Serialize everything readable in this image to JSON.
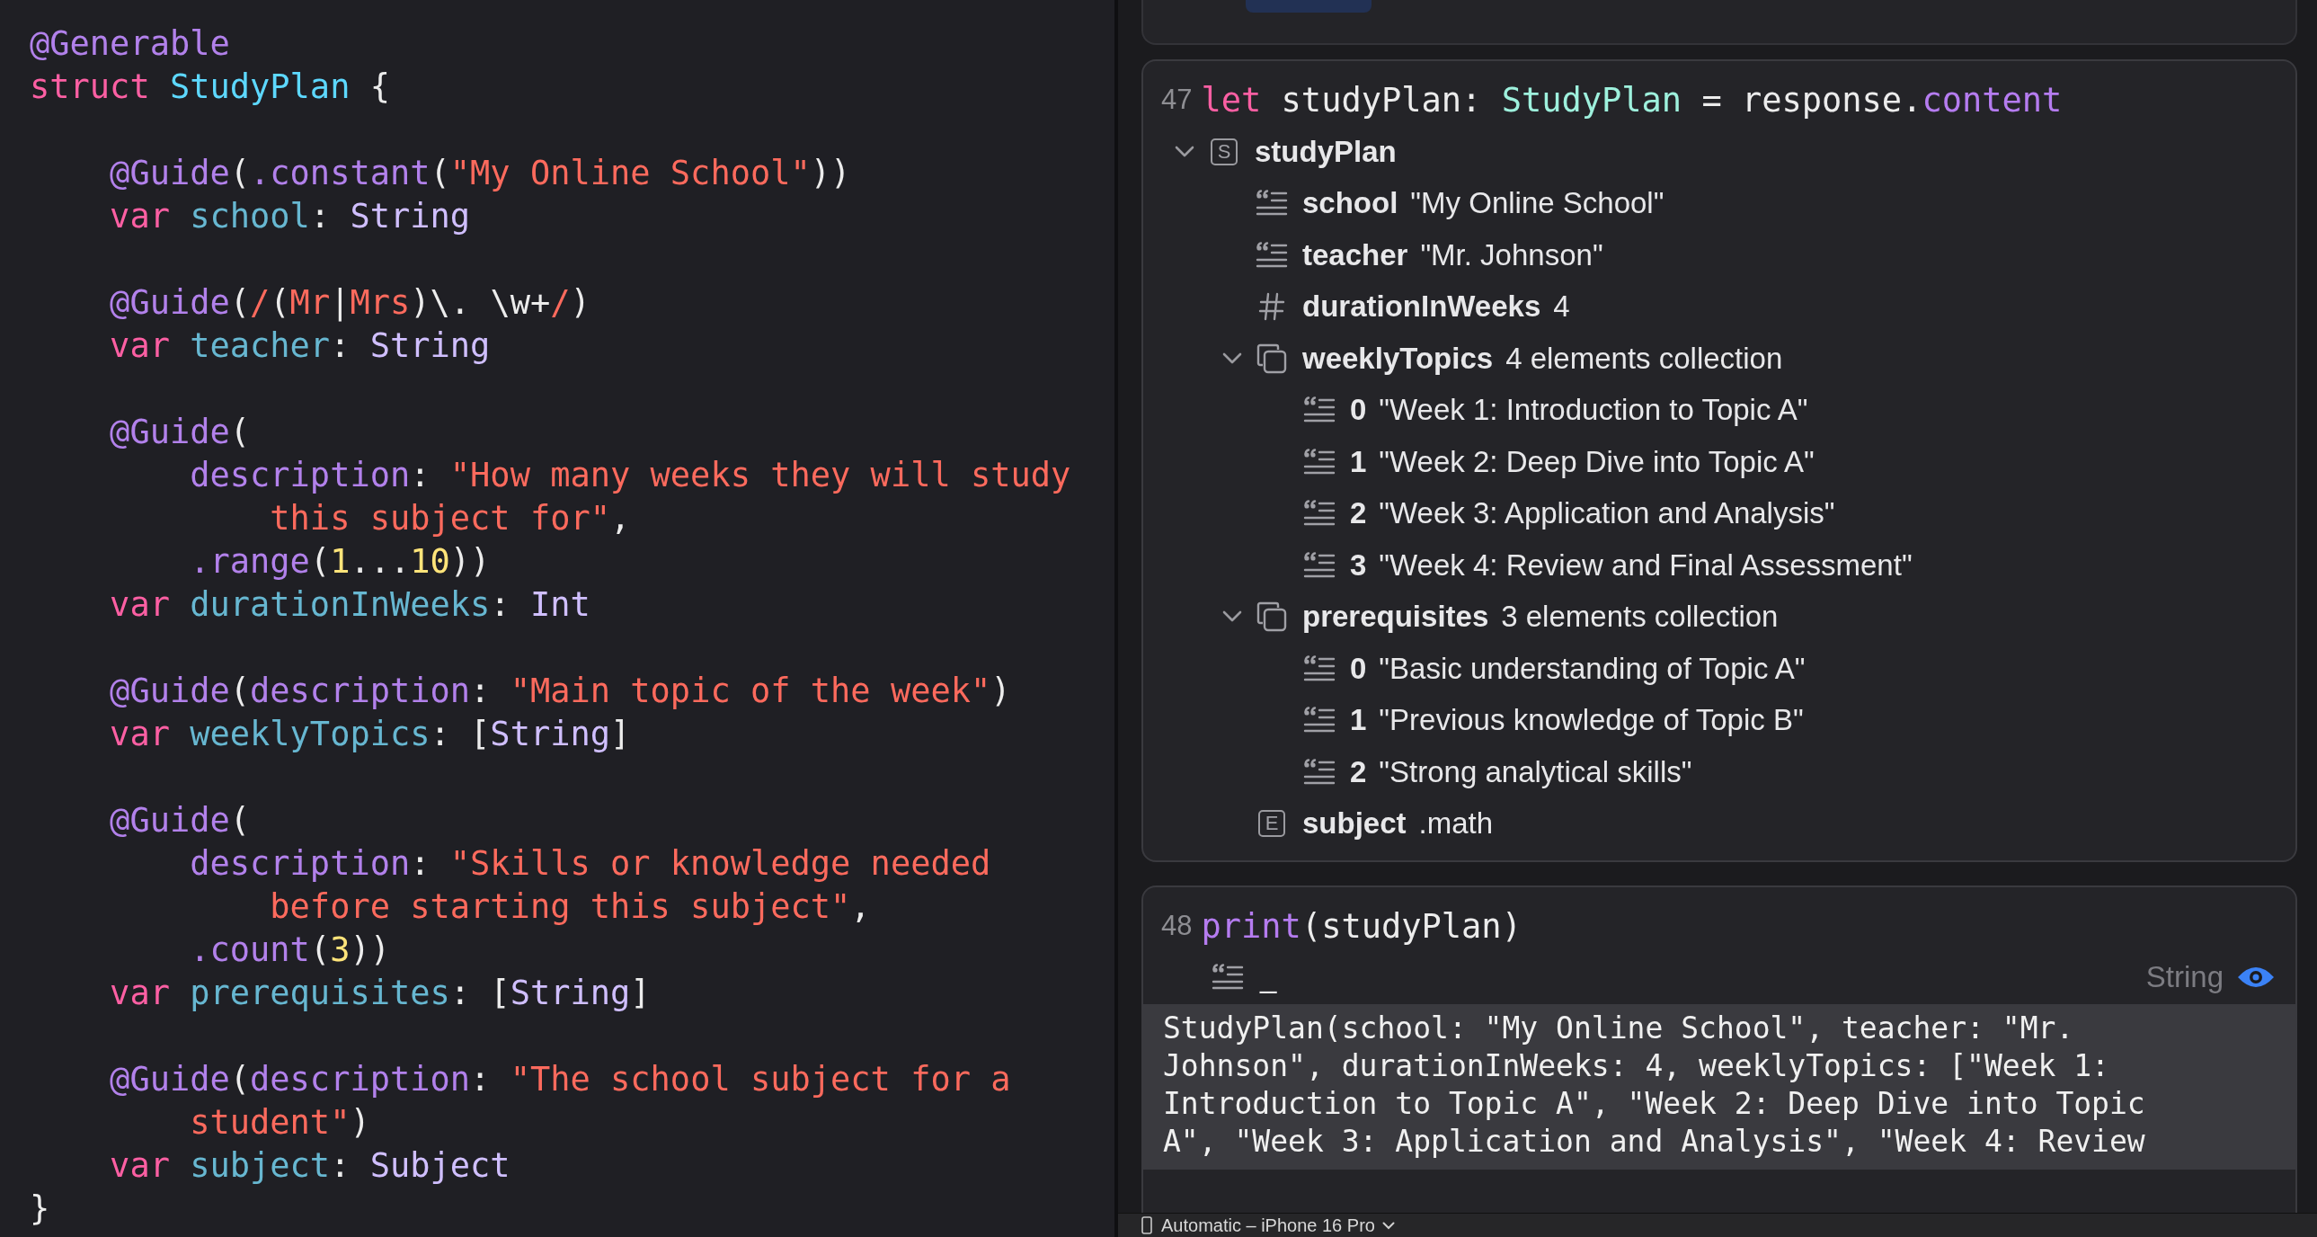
{
  "editor": {
    "blocks": [
      [
        [
          {
            "text": "@Generable",
            "kind": "attr"
          }
        ],
        [
          {
            "text": "struct",
            "kind": "keyword"
          },
          {
            "text": " StudyPlan",
            "kind": "type"
          },
          {
            "text": " {",
            "kind": "plain"
          }
        ]
      ],
      [
        [
          {
            "text": "    @Guide",
            "kind": "attr"
          },
          {
            "text": "(",
            "kind": "plain"
          },
          {
            "text": ".constant",
            "kind": "attr"
          },
          {
            "text": "(",
            "kind": "plain"
          },
          {
            "text": "\"My Online School\"",
            "kind": "string"
          },
          {
            "text": "))",
            "kind": "plain"
          }
        ],
        [
          {
            "text": "    var",
            "kind": "keyword"
          },
          {
            "text": " school",
            "kind": "ident"
          },
          {
            "text": ": ",
            "kind": "plain"
          },
          {
            "text": "String",
            "kind": "type2"
          }
        ]
      ],
      [
        [
          {
            "text": "    @Guide",
            "kind": "attr"
          },
          {
            "text": "(",
            "kind": "plain"
          },
          {
            "text": "/",
            "kind": "string"
          },
          {
            "text": "(",
            "kind": "plain"
          },
          {
            "text": "Mr",
            "kind": "string"
          },
          {
            "text": "|",
            "kind": "plain"
          },
          {
            "text": "Mrs",
            "kind": "string"
          },
          {
            "text": ")\\. \\w+",
            "kind": "plain"
          },
          {
            "text": "/",
            "kind": "string"
          },
          {
            "text": ")",
            "kind": "plain"
          }
        ],
        [
          {
            "text": "    var",
            "kind": "keyword"
          },
          {
            "text": " teacher",
            "kind": "ident"
          },
          {
            "text": ": ",
            "kind": "plain"
          },
          {
            "text": "String",
            "kind": "type2"
          }
        ]
      ],
      [
        [
          {
            "text": "    @Guide",
            "kind": "attr"
          },
          {
            "text": "(",
            "kind": "plain"
          }
        ],
        [
          {
            "text": "        description",
            "kind": "attr"
          },
          {
            "text": ": ",
            "kind": "plain"
          },
          {
            "text": "\"How many weeks they will study",
            "kind": "string"
          }
        ],
        [
          {
            "text": "            this subject for\"",
            "kind": "string"
          },
          {
            "text": ",",
            "kind": "plain"
          }
        ],
        [
          {
            "text": "        .range",
            "kind": "attr"
          },
          {
            "text": "(",
            "kind": "plain"
          },
          {
            "text": "1",
            "kind": "number"
          },
          {
            "text": "...",
            "kind": "plain"
          },
          {
            "text": "10",
            "kind": "number"
          },
          {
            "text": "))",
            "kind": "plain"
          }
        ],
        [
          {
            "text": "    var",
            "kind": "keyword"
          },
          {
            "text": " durationInWeeks",
            "kind": "ident"
          },
          {
            "text": ": ",
            "kind": "plain"
          },
          {
            "text": "Int",
            "kind": "type2"
          }
        ]
      ],
      [
        [
          {
            "text": "    @Guide",
            "kind": "attr"
          },
          {
            "text": "(",
            "kind": "plain"
          },
          {
            "text": "description",
            "kind": "attr"
          },
          {
            "text": ": ",
            "kind": "plain"
          },
          {
            "text": "\"Main topic of the week\"",
            "kind": "string"
          },
          {
            "text": ")",
            "kind": "plain"
          }
        ],
        [
          {
            "text": "    var",
            "kind": "keyword"
          },
          {
            "text": " weeklyTopics",
            "kind": "ident"
          },
          {
            "text": ": [",
            "kind": "plain"
          },
          {
            "text": "String",
            "kind": "type2"
          },
          {
            "text": "]",
            "kind": "plain"
          }
        ]
      ],
      [
        [
          {
            "text": "    @Guide",
            "kind": "attr"
          },
          {
            "text": "(",
            "kind": "plain"
          }
        ],
        [
          {
            "text": "        description",
            "kind": "attr"
          },
          {
            "text": ": ",
            "kind": "plain"
          },
          {
            "text": "\"Skills or knowledge needed",
            "kind": "string"
          }
        ],
        [
          {
            "text": "            before starting this subject\"",
            "kind": "string"
          },
          {
            "text": ",",
            "kind": "plain"
          }
        ],
        [
          {
            "text": "        .count",
            "kind": "attr"
          },
          {
            "text": "(",
            "kind": "plain"
          },
          {
            "text": "3",
            "kind": "number"
          },
          {
            "text": "))",
            "kind": "plain"
          }
        ],
        [
          {
            "text": "    var",
            "kind": "keyword"
          },
          {
            "text": " prerequisites",
            "kind": "ident"
          },
          {
            "text": ": [",
            "kind": "plain"
          },
          {
            "text": "String",
            "kind": "type2"
          },
          {
            "text": "]",
            "kind": "plain"
          }
        ]
      ],
      [
        [
          {
            "text": "    @Guide",
            "kind": "attr"
          },
          {
            "text": "(",
            "kind": "plain"
          },
          {
            "text": "description",
            "kind": "attr"
          },
          {
            "text": ": ",
            "kind": "plain"
          },
          {
            "text": "\"The school subject for a",
            "kind": "string"
          }
        ],
        [
          {
            "text": "        student\"",
            "kind": "string"
          },
          {
            "text": ")",
            "kind": "plain"
          }
        ],
        [
          {
            "text": "    var",
            "kind": "keyword"
          },
          {
            "text": " subject",
            "kind": "ident"
          },
          {
            "text": ": ",
            "kind": "plain"
          },
          {
            "text": "Subject",
            "kind": "type2"
          }
        ],
        [
          {
            "text": "}",
            "kind": "plain"
          }
        ]
      ]
    ]
  },
  "results": [
    {
      "line_number": "47",
      "code": [
        {
          "text": "let",
          "kind": "keyword"
        },
        {
          "text": " studyPlan: ",
          "kind": "plain"
        },
        {
          "text": "StudyPlan",
          "kind": "type3"
        },
        {
          "text": " = response.",
          "kind": "plain"
        },
        {
          "text": "content",
          "kind": "member"
        }
      ],
      "tree": [
        {
          "name": "studyPlan",
          "kind": "struct",
          "badge": "S",
          "expanded": true,
          "children": [
            {
              "name": "school",
              "value": "\"My Online School\"",
              "kind": "string"
            },
            {
              "name": "teacher",
              "value": "\"Mr. Johnson\"",
              "kind": "string"
            },
            {
              "name": "durationInWeeks",
              "value": "4",
              "kind": "number"
            },
            {
              "name": "weeklyTopics",
              "value": "4 elements collection",
              "kind": "collection",
              "expanded": true,
              "children": [
                {
                  "name": "0",
                  "value": "\"Week 1: Introduction to Topic A\"",
                  "kind": "string"
                },
                {
                  "name": "1",
                  "value": "\"Week 2: Deep Dive into Topic A\"",
                  "kind": "string"
                },
                {
                  "name": "2",
                  "value": "\"Week 3: Application and Analysis\"",
                  "kind": "string"
                },
                {
                  "name": "3",
                  "value": "\"Week 4: Review and Final Assessment\"",
                  "kind": "string"
                }
              ]
            },
            {
              "name": "prerequisites",
              "value": "3 elements collection",
              "kind": "collection",
              "expanded": true,
              "children": [
                {
                  "name": "0",
                  "value": "\"Basic understanding of Topic A\"",
                  "kind": "string"
                },
                {
                  "name": "1",
                  "value": "\"Previous knowledge of Topic B\"",
                  "kind": "string"
                },
                {
                  "name": "2",
                  "value": "\"Strong analytical skills\"",
                  "kind": "string"
                }
              ]
            },
            {
              "name": "subject",
              "value": ".math",
              "kind": "enum",
              "badge": "E"
            }
          ]
        }
      ]
    },
    {
      "line_number": "48",
      "code": [
        {
          "text": "print",
          "kind": "member"
        },
        {
          "text": "(studyPlan)",
          "kind": "plain"
        }
      ],
      "result": {
        "kind": "string",
        "value": "_",
        "type": "String",
        "preview_visible": true
      },
      "output": [
        "StudyPlan(school: \"My Online School\", teacher: \"Mr.",
        "Johnson\", durationInWeeks: 4, weeklyTopics: [\"Week 1:",
        "Introduction to Topic A\", \"Week 2: Deep Dive into Topic",
        "A\", \"Week 3: Application and Analysis\", \"Week 4: Review"
      ]
    }
  ],
  "status_bar": {
    "device": "Automatic – iPhone 16 Pro"
  }
}
